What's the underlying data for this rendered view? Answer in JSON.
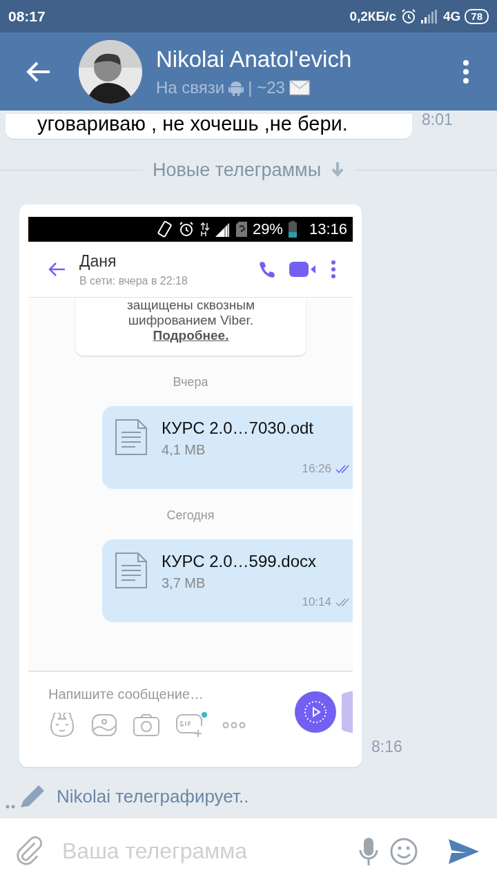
{
  "status_bar": {
    "time": "08:17",
    "speed": "0,2КБ/с",
    "network": "4G",
    "battery": "78"
  },
  "header": {
    "title": "Nikolai Anatol'evich",
    "status": "На связи",
    "counter": "| ~23"
  },
  "messages": [
    {
      "kind": "text",
      "text": "уговариваю , не хочешь ,не бери.",
      "time": "8:01"
    },
    {
      "kind": "divider",
      "text": "Новые телеграммы"
    },
    {
      "kind": "screenshot",
      "time": "8:16",
      "screenshot": {
        "status_bar": {
          "battery": "29%",
          "time": "13:16"
        },
        "header": {
          "name": "Даня",
          "status": "В сети: вчера в 22:18"
        },
        "items": [
          {
            "kind": "notice",
            "lines": [
              "защищены сквозным",
              "шифрованием Viber."
            ],
            "link": "Подробнее."
          },
          {
            "kind": "date",
            "text": "Вчера"
          },
          {
            "kind": "file",
            "name": "КУРС 2.0…7030.odt",
            "size": "4,1 MB",
            "time": "16:26",
            "read": true
          },
          {
            "kind": "date",
            "text": "Сегодня"
          },
          {
            "kind": "file",
            "name": "КУРС 2.0…599.docx",
            "size": "3,7 MB",
            "time": "10:14",
            "read": false
          }
        ],
        "composer": {
          "placeholder": "Напишите сообщение…"
        }
      }
    }
  ],
  "typing": "Nikolai телеграфирует..",
  "composer": {
    "placeholder": "Ваша телеграмма"
  }
}
